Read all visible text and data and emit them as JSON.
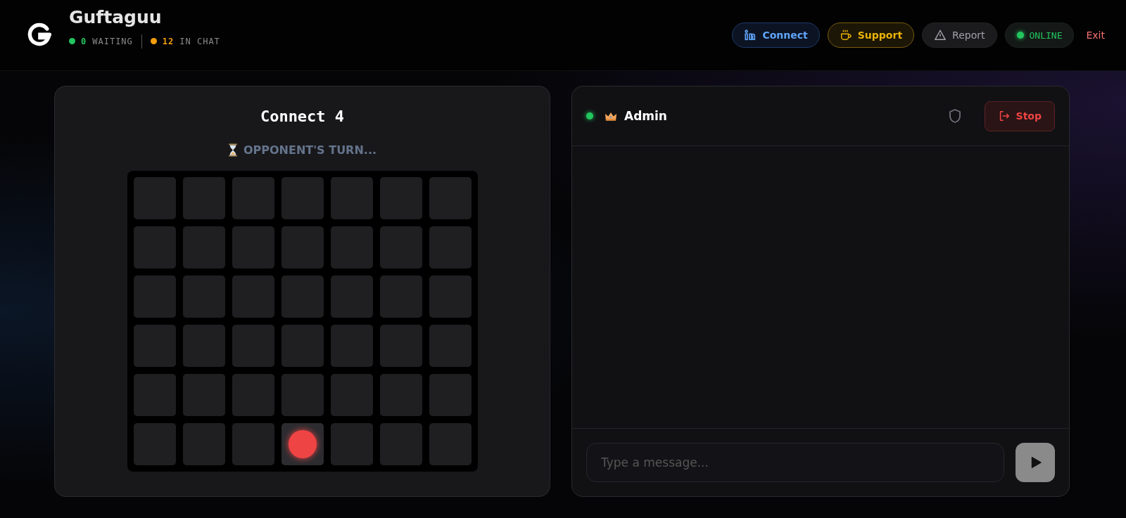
{
  "header": {
    "brand": "Guftaguu",
    "stats": [
      {
        "count": "0",
        "label": "WAITING",
        "color": "#22c55e"
      },
      {
        "count": "12",
        "label": "IN CHAT",
        "color": "#f59e0b"
      }
    ],
    "actions": [
      {
        "kind": "connect",
        "label": "Connect"
      },
      {
        "kind": "support",
        "label": "Support"
      },
      {
        "kind": "report",
        "label": "Report"
      },
      {
        "kind": "status",
        "label": "ONLINE"
      },
      {
        "kind": "exit",
        "label": "Exit"
      }
    ]
  },
  "game": {
    "title": "Connect 4",
    "status": "OPPONENT'S TURN...",
    "board": [
      [
        {
          "occupied": false
        },
        {
          "occupied": false
        },
        {
          "occupied": false
        },
        {
          "occupied": false
        },
        {
          "occupied": false
        },
        {
          "occupied": false
        },
        {
          "occupied": false
        }
      ],
      [
        {
          "occupied": false
        },
        {
          "occupied": false
        },
        {
          "occupied": false
        },
        {
          "occupied": false
        },
        {
          "occupied": false
        },
        {
          "occupied": false
        },
        {
          "occupied": false
        }
      ],
      [
        {
          "occupied": false
        },
        {
          "occupied": false
        },
        {
          "occupied": false
        },
        {
          "occupied": false
        },
        {
          "occupied": false
        },
        {
          "occupied": false
        },
        {
          "occupied": false
        }
      ],
      [
        {
          "occupied": false
        },
        {
          "occupied": false
        },
        {
          "occupied": false
        },
        {
          "occupied": false
        },
        {
          "occupied": false
        },
        {
          "occupied": false
        },
        {
          "occupied": false
        }
      ],
      [
        {
          "occupied": false
        },
        {
          "occupied": false
        },
        {
          "occupied": false
        },
        {
          "occupied": false
        },
        {
          "occupied": false
        },
        {
          "occupied": false
        },
        {
          "occupied": false
        }
      ],
      [
        {
          "occupied": false
        },
        {
          "occupied": false
        },
        {
          "occupied": false
        },
        {
          "occupied": true,
          "color": "#ef4444"
        },
        {
          "occupied": false
        },
        {
          "occupied": false
        },
        {
          "occupied": false
        }
      ]
    ]
  },
  "chat": {
    "partner": "Admin",
    "online": true,
    "stop_label": "Stop",
    "message_placeholder": "Type a message..."
  }
}
